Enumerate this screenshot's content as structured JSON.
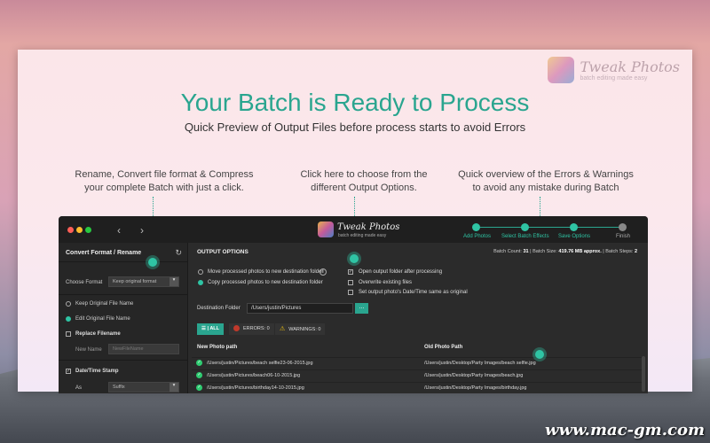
{
  "brand": {
    "name": "Tweak Photos",
    "tagline": "batch editing made easy"
  },
  "headline": "Your Batch is Ready to Process",
  "subheadline": "Quick Preview of Output Files before process starts to avoid Errors",
  "notes": [
    "Rename, Convert file format & Compress\nyour complete Batch with just a click.",
    "Click here to choose from the\ndifferent Output Options.",
    "Quick overview of the Errors & Warnings\nto avoid any mistake during Batch"
  ],
  "app": {
    "name": "Tweak Photos",
    "tagline": "batch editing made easy",
    "steps": [
      {
        "label": "Add Photos",
        "active": true
      },
      {
        "label": "Select Batch Effects",
        "active": true
      },
      {
        "label": "Save Options",
        "active": true
      },
      {
        "label": "Finish",
        "active": false
      }
    ],
    "left": {
      "title": "Convert Format / Rename",
      "choose_format_label": "Choose Format",
      "choose_format_value": "Keep original format",
      "keep_name": "Keep Original File Name",
      "edit_name": "Edit Original File Name",
      "replace_filename": "Replace Filename",
      "new_name_label": "New Name",
      "new_name_placeholder": "NewFileName",
      "date_time_stamp": "Date/Time Stamp",
      "as_label": "As",
      "as_value": "Suffix"
    },
    "output": {
      "title": "OUTPUT OPTIONS",
      "batch_count_label": "Batch Count:",
      "batch_count": "31",
      "batch_size_label": "Batch Size:",
      "batch_size": "419.76 MB approx.",
      "batch_steps_label": "Batch Steps:",
      "batch_steps": "2",
      "move_option": "Move processed photos to new destination folder",
      "copy_option": "Copy processed photos to new destination folder",
      "open_folder": "Open output folder after processing",
      "overwrite": "Overwrite existing files",
      "set_date": "Set output photo's Date/Time same as original",
      "dest_label": "Destination Folder",
      "dest_value": "/Users/justin/Pictures",
      "browse": "...",
      "filter_all": "ALL",
      "filter_errors": "ERRORS: 0",
      "filter_warnings": "WARNINGS: 0",
      "col_new": "New Photo path",
      "col_old": "Old Photo Path",
      "rows": [
        {
          "new": "/Users/justin/Pictures/beach selfie23-06-2015.jpg",
          "old": "/Users/justin/Desktop/Party Images/beach selfie.jpg"
        },
        {
          "new": "/Users/justin/Pictures/beach06-10-2015.jpg",
          "old": "/Users/justin/Desktop/Party Images/beach.jpg"
        },
        {
          "new": "/Users/justin/Pictures/birthday14-10-2015.jpg",
          "old": "/Users/justin/Desktop/Party Images/birthday.jpg"
        }
      ]
    }
  },
  "watermark": "www.mac-gm.com",
  "colors": {
    "accent": "#2aa58f",
    "window_bg": "#2b2b2b"
  }
}
